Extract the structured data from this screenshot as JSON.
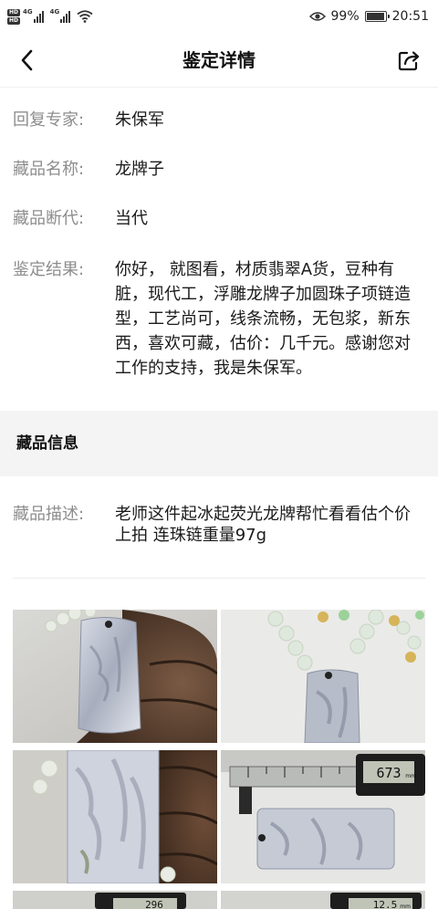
{
  "status_bar": {
    "hd1": "HD",
    "hd2": "HD",
    "net1": "4G",
    "net2": "4G",
    "battery_text": "99%",
    "time": "20:51",
    "battery_level": 0.99
  },
  "header": {
    "title": "鉴定详情",
    "back_icon": "chevron-left-icon",
    "share_icon": "share-icon"
  },
  "appraisal": {
    "expert_label": "回复专家:",
    "expert_value": "朱保军",
    "name_label": "藏品名称:",
    "name_value": "龙牌子",
    "era_label": "藏品断代:",
    "era_value": "当代",
    "result_label": "鉴定结果:",
    "result_value": "你好， 就图看，材质翡翠A货，豆种有脏，现代工，浮雕龙牌子加圆珠子项链造型，工艺尚可，线条流畅，无包浆，新东西，喜欢可藏，估价：几千元。感谢您对工作的支持，我是朱保军。"
  },
  "collection_info": {
    "section_title": "藏品信息",
    "desc_label": "藏品描述:",
    "desc_value": "老师这件起冰起荧光龙牌帮忙看看估个价上拍 连珠链重量97g"
  },
  "photos": {
    "caliper_reading_1": "673",
    "caliper_unit_1": "mm",
    "caliper_reading_2": "12.5",
    "caliper_unit_2": "mm",
    "caliper_reading_3": "296"
  },
  "colors": {
    "label_gray": "#8d8d8d",
    "band_gray": "#f4f4f4",
    "text_dark": "#1a1a1a"
  }
}
